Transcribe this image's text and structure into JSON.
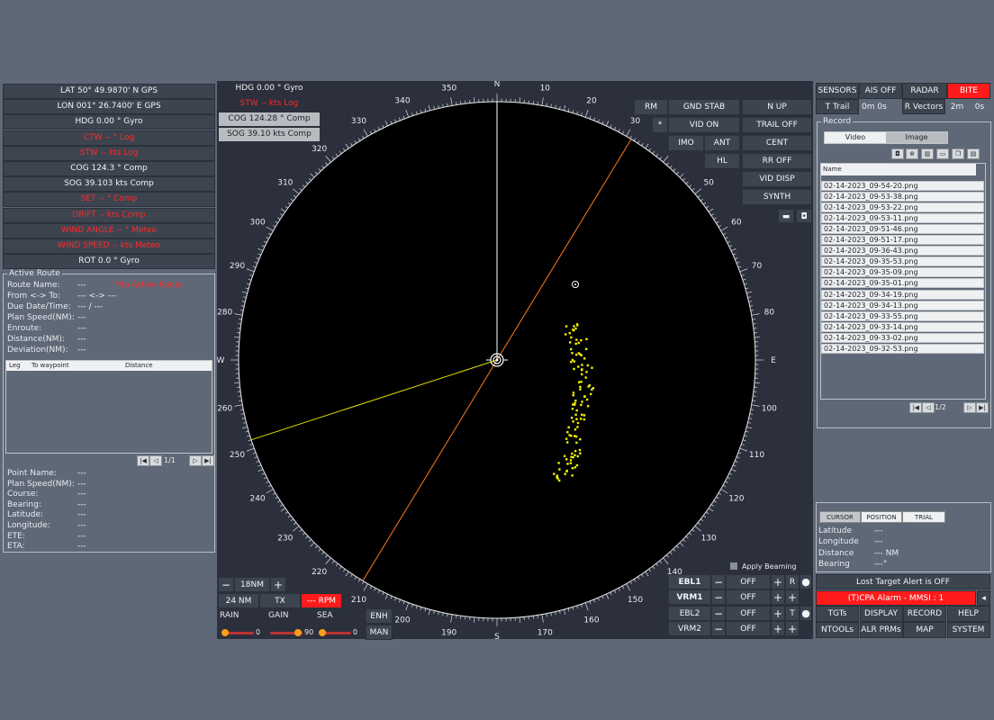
{
  "nav_data": [
    {
      "text": "LAT 50° 49.9870' N  GPS",
      "color": "white"
    },
    {
      "text": "LON 001° 26.7400' E  GPS",
      "color": "white"
    },
    {
      "text": "HDG  0.00 °   Gyro",
      "color": "white"
    },
    {
      "text": "CTW  -- °   Log",
      "color": "red"
    },
    {
      "text": "STW  -- kts   Log",
      "color": "red"
    },
    {
      "text": "COG  124.3 °   Comp",
      "color": "white"
    },
    {
      "text": "SOG  39.103 kts  Comp",
      "color": "white"
    },
    {
      "text": "SET  -- °   Comp",
      "color": "red"
    },
    {
      "text": "DRIFT  -- kts   Comp",
      "color": "red"
    },
    {
      "text": "WIND ANGLE  -- °   Meteo",
      "color": "red"
    },
    {
      "text": "WIND SPEED  -- kts  Meteo",
      "color": "red"
    },
    {
      "text": "ROT  0.0 °  Gyro",
      "color": "white"
    }
  ],
  "active_route": {
    "legend": "Active Route",
    "route_name_label": "Route Name:",
    "route_name_value": "---",
    "route_warning": "*No Active Route",
    "from_to_label": "From <-> To:",
    "from_to_value": "--- <-> ---",
    "due_label": "Due Date/Time:",
    "due_value": "---   /   ---",
    "plan_speed_label": "Plan Speed(NM):",
    "plan_speed_value": "---",
    "enroute_label": "Enroute:",
    "enroute_value": "---",
    "distance_label": "Distance(NM):",
    "distance_value": "---",
    "deviation_label": "Deviation(NM):",
    "deviation_value": "---",
    "col_leg": "Leg",
    "col_to": "To waypoint",
    "col_distance": "Distance",
    "pager": "1/1",
    "point_fields": [
      {
        "label": "Point Name:",
        "value": "---"
      },
      {
        "label": "Plan Speed(NM):",
        "value": "---"
      },
      {
        "label": "Course:",
        "value": "---"
      },
      {
        "label": "Bearing:",
        "value": "---"
      },
      {
        "label": "Latitude:",
        "value": "---"
      },
      {
        "label": "Longitude:",
        "value": "---"
      },
      {
        "label": "ETE:",
        "value": "---"
      },
      {
        "label": "ETA:",
        "value": "---"
      }
    ]
  },
  "radar_top_left": [
    {
      "text": "HDG  0.00 °      Gyro",
      "style": "dark"
    },
    {
      "text": "STW  -- kts      Log",
      "style": "red"
    },
    {
      "text": "COG  124.28 °  Comp",
      "style": "light"
    },
    {
      "text": "SOG  39.10 kts  Comp",
      "style": "light"
    }
  ],
  "radar_buttons": {
    "rm": "RM",
    "gnd_stab": "GND STAB",
    "n_up": "N UP",
    "star": "*",
    "vid_on": "VID ON",
    "trail_off": "TRAIL OFF",
    "imo": "IMO",
    "ant": "ANT",
    "cent": "CENT",
    "hl": "HL",
    "rr_off": "RR OFF",
    "vid_disp": "VID DISP",
    "synth": "SYNTH"
  },
  "range": {
    "minus": "−",
    "value": "18NM",
    "plus": "+",
    "ring": "24 NM",
    "tx": "TX",
    "rpm": "--- RPM",
    "rain_label": "RAIN",
    "gain_label": "GAIN",
    "sea_label": "SEA",
    "rain_value": "0",
    "gain_value": "90",
    "sea_value": "0",
    "enh": "ENH",
    "man": "MAN"
  },
  "ebl_vrm": {
    "apply_beaming": "Apply Beaming",
    "rows": [
      {
        "name": "EBL1",
        "value": "OFF",
        "bold": true
      },
      {
        "name": "VRM1",
        "value": "OFF",
        "bold": true
      },
      {
        "name": "EBL2",
        "value": "OFF",
        "bold": false
      },
      {
        "name": "VRM2",
        "value": "OFF",
        "bold": false
      }
    ],
    "r_label": "R",
    "t_label": "T"
  },
  "top_right": {
    "sensors": "SENSORS",
    "ais_off": "AIS OFF",
    "radar": "RADAR",
    "bite": "BITE",
    "t_trail": "T Trail",
    "trail_time": "0m 0s",
    "r_vectors": "R Vectors",
    "vec_min": "2m",
    "vec_sec": "0s"
  },
  "record": {
    "legend": "Record",
    "tab_video": "Video",
    "tab_image": "Image",
    "col_name": "Name",
    "files": [
      "02-14-2023_09-54-20.png",
      "02-14-2023_09-53-38.png",
      "02-14-2023_09-53-22.png",
      "02-14-2023_09-53-11.png",
      "02-14-2023_09-51-46.png",
      "02-14-2023_09-51-17.png",
      "02-14-2023_09-36-43.png",
      "02-14-2023_09-35-53.png",
      "02-14-2023_09-35-09.png",
      "02-14-2023_09-35-01.png",
      "02-14-2023_09-34-19.png",
      "02-14-2023_09-34-13.png",
      "02-14-2023_09-33-55.png",
      "02-14-2023_09-33-14.png",
      "02-14-2023_09-33-02.png",
      "02-14-2023_09-32-53.png"
    ],
    "pager": "1/2"
  },
  "cursor_panel": {
    "tab_cursor": "CURSOR",
    "tab_position": "POSITION",
    "tab_trial": "TRIAL",
    "fields": [
      {
        "label": "Latitude",
        "value": "---"
      },
      {
        "label": "Longitude",
        "value": "---"
      },
      {
        "label": "Distance",
        "value": "--- NM"
      },
      {
        "label": "Bearing",
        "value": "---°"
      }
    ]
  },
  "alerts": {
    "lost_target": "Lost Target Alert is OFF",
    "cpa": "(T)CPA Alarm - MMSI : 1"
  },
  "bottom_menu": [
    [
      "TGTs",
      "DISPLAY",
      "RECORD",
      "HELP"
    ],
    [
      "NTOOLs",
      "ALR PRMs",
      "MAP",
      "SYSTEM"
    ]
  ],
  "radar_scope": {
    "compass_labels": [
      "N",
      "10",
      "20",
      "30",
      "40",
      "50",
      "60",
      "70",
      "80",
      "E",
      "100",
      "110",
      "120",
      "130",
      "140",
      "150",
      "160",
      "170",
      "S",
      "190",
      "200",
      "210",
      "220",
      "230",
      "240",
      "250",
      "260",
      "W",
      "280",
      "290",
      "300",
      "310",
      "320",
      "330",
      "340",
      "350"
    ],
    "heading_deg": 0,
    "cog_deg": 124.28,
    "ebl_deg": 252
  },
  "colors": {
    "alarm_red": "#ff1b1b",
    "echo": "#f4f000",
    "ebl_line": "#e0e000",
    "cog_line": "#ff7a1a"
  }
}
